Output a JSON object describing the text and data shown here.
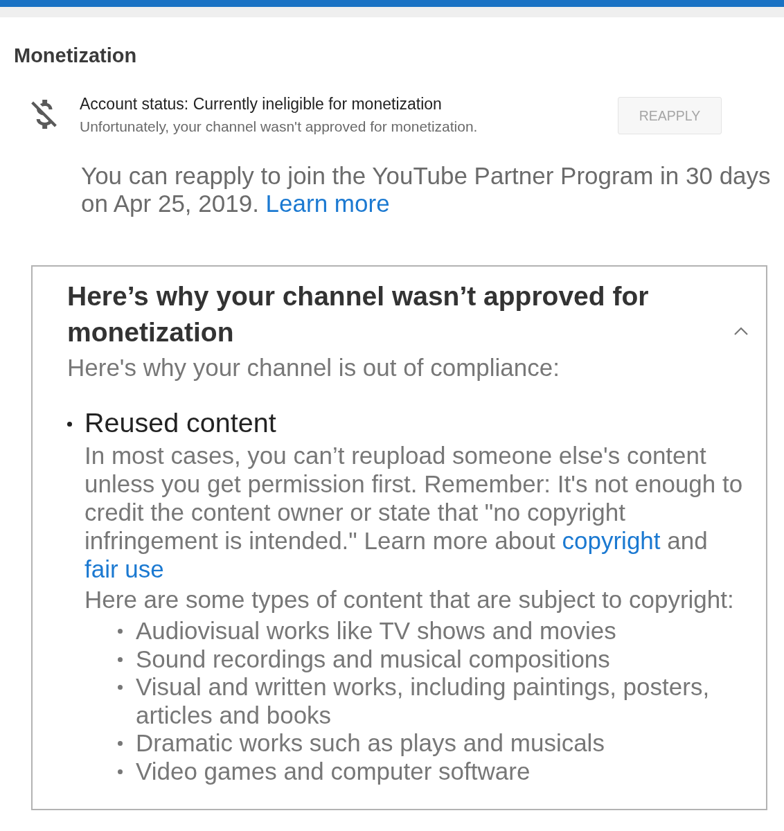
{
  "section": {
    "title": "Monetization"
  },
  "account_status": {
    "title": "Account status: Currently ineligible for monetization",
    "description": "Unfortunately, your channel wasn't approved for monetization.",
    "button": {
      "label": "REAPPLY",
      "disabled": true
    }
  },
  "reapply_notice": {
    "text": "You can reapply to join the YouTube Partner Program in 30 days on Apr 25, 2019.",
    "link": "Learn more"
  },
  "reasons_panel": {
    "title": "Here’s why your channel wasn’t approved for monetization",
    "expanded": true,
    "intro": "Here's why your channel is out of compliance:",
    "reasons": [
      {
        "title": "Reused content",
        "description": [
          {
            "kind": "text",
            "text": "In most cases, you can’t reupload someone else's content unless you get permission first. Remember: It's not enough to credit the content owner or state that \"no copyright infringement is intended.\" Learn more about "
          },
          {
            "kind": "link",
            "text": "copyright"
          },
          {
            "kind": "text",
            "text": " and "
          },
          {
            "kind": "link",
            "text": "fair use"
          }
        ],
        "examples_intro": "Here are some types of content that are subject to copyright:",
        "examples": [
          "Audiovisual works like TV shows and movies",
          "Sound recordings and musical compositions",
          "Visual and written works, including paintings, posters, articles and books",
          "Dramatic works such as plays and musicals",
          "Video games and computer software"
        ]
      }
    ]
  }
}
